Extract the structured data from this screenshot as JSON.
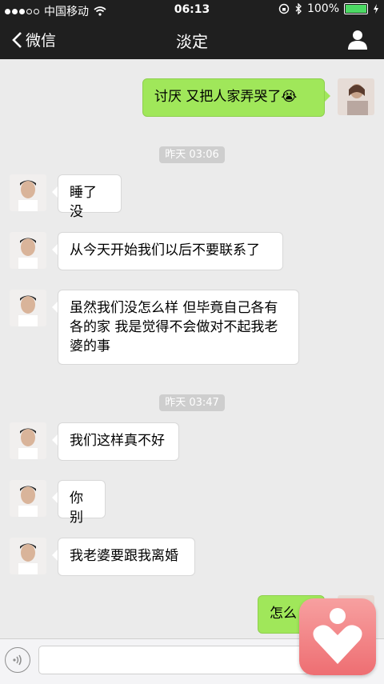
{
  "status_bar": {
    "carrier": "中国移动",
    "time": "06:13",
    "battery": "100%"
  },
  "nav": {
    "back_label": "微信",
    "title": "淡定"
  },
  "messages": [
    {
      "side": "right",
      "text": "讨厌  又把人家弄哭了😭"
    },
    {
      "side": "left",
      "text": "睡了没"
    },
    {
      "side": "left",
      "text": "从今天开始我们以后不要联系了"
    },
    {
      "side": "left",
      "text": "虽然我们没怎么样 但毕竟自己各有各的家 我是觉得不会做对不起我老婆的事"
    },
    {
      "side": "left",
      "text": "我们这样真不好"
    },
    {
      "side": "left",
      "text": "你别"
    },
    {
      "side": "left",
      "text": "我老婆要跟我离婚"
    },
    {
      "side": "right",
      "text": "怎么"
    }
  ],
  "timestamps": [
    "昨天 03:06",
    "昨天 03:47"
  ],
  "colors": {
    "bar_bg": "#1f1f1f",
    "chat_bg": "#ebebeb",
    "bubble_self": "#a0e75a",
    "bubble_other": "#ffffff"
  }
}
